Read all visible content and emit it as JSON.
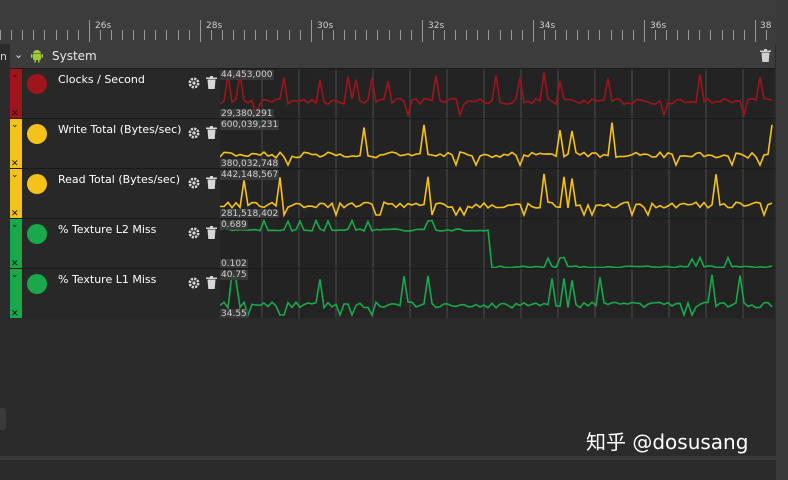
{
  "timeline": {
    "ticks": [
      "26s",
      "28s",
      "30s",
      "32s",
      "34s",
      "36s",
      "38"
    ]
  },
  "left_fragment": "n",
  "panel": {
    "title": "System",
    "rows": [
      {
        "label": "Clocks / Second",
        "color": "#a0141b",
        "max": "44,453,000",
        "min": "29,380,291"
      },
      {
        "label": "Write Total (Bytes/sec)",
        "color": "#f5c21b",
        "max": "600,039,231",
        "min": "380,032,748"
      },
      {
        "label": "Read Total (Bytes/sec)",
        "color": "#f5c21b",
        "max": "442,148,567",
        "min": "281,518,402"
      },
      {
        "label": "% Texture L2 Miss",
        "color": "#19a84a",
        "max": "0.689",
        "min": "0.102"
      },
      {
        "label": "% Texture L1 Miss",
        "color": "#19a84a",
        "max": "40.75",
        "min": "34.55"
      }
    ]
  },
  "watermark": "知乎 @dosusang"
}
